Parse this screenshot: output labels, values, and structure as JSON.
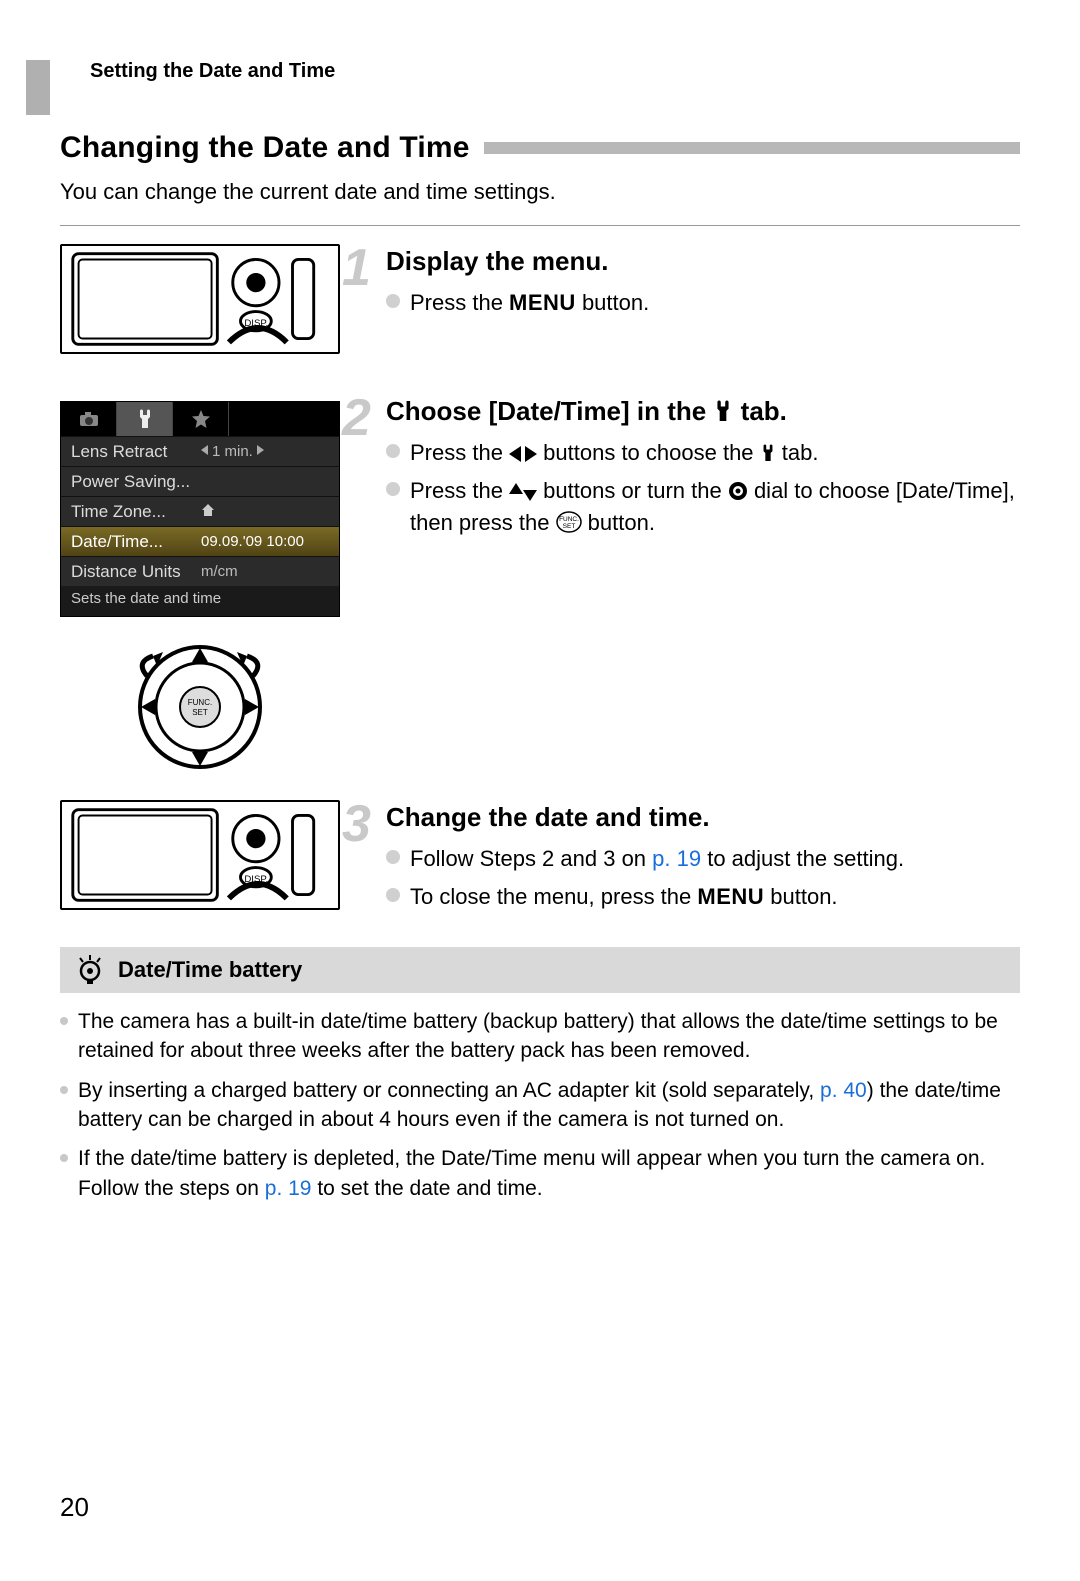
{
  "header": "Setting the Date and Time",
  "section_title": "Changing the Date and Time",
  "intro": "You can change the current date and time settings.",
  "steps": {
    "s1": {
      "num": "1",
      "title": "Display the menu.",
      "b1_pre": "Press the ",
      "b1_menu": "MENU",
      "b1_post": " button."
    },
    "s2": {
      "num": "2",
      "title_pre": "Choose [Date/Time] in the ",
      "title_post": " tab.",
      "b1_pre": "Press the ",
      "b1_mid": " buttons to choose the ",
      "b1_post": " tab.",
      "b2_pre": "Press the ",
      "b2_mid1": " buttons or turn the ",
      "b2_mid2": " dial to choose [Date/Time], then press the ",
      "b2_post": " button."
    },
    "s3": {
      "num": "3",
      "title": "Change the date and time.",
      "b1_pre": "Follow Steps 2 and 3 on ",
      "b1_link": "p. 19",
      "b1_post": " to adjust the setting.",
      "b2_pre": "To close the menu, press the ",
      "b2_menu": "MENU",
      "b2_post": " button."
    }
  },
  "menu": {
    "tab_icons": {
      "camera": "camera-icon",
      "tools": "tools-icon",
      "star": "star-icon"
    },
    "rows": {
      "r1": {
        "label": "Lens Retract",
        "val": "1 min."
      },
      "r2": {
        "label": "Power Saving...",
        "val": ""
      },
      "r3": {
        "label": "Time Zone...",
        "val": ""
      },
      "r4": {
        "label": "Date/Time...",
        "val": "09.09.'09 10:00"
      },
      "r5": {
        "label": "Distance Units",
        "val": "m/cm"
      }
    },
    "footer": "Sets the date and time"
  },
  "tip": {
    "title": "Date/Time battery",
    "b1": "The camera has a built-in date/time battery (backup battery) that allows the date/time settings to be retained for about three weeks after the battery pack has been removed.",
    "b2_pre": "By inserting a charged battery or connecting an AC adapter kit (sold separately, ",
    "b2_link": "p. 40",
    "b2_post": ") the date/time battery can be charged in about 4 hours even if the camera is not turned on.",
    "b3_pre": "If the date/time battery is depleted, the Date/Time menu will appear when you turn the camera on. Follow the steps on ",
    "b3_link": "p. 19",
    "b3_post": " to set the date and time."
  },
  "page_number": "20"
}
